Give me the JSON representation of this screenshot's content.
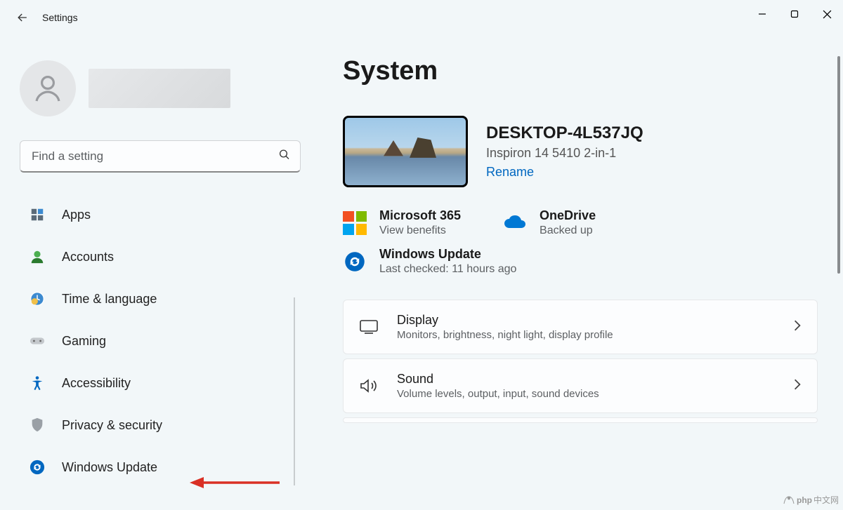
{
  "app_title": "Settings",
  "search": {
    "placeholder": "Find a setting"
  },
  "nav": {
    "apps": "Apps",
    "accounts": "Accounts",
    "time_language": "Time & language",
    "gaming": "Gaming",
    "accessibility": "Accessibility",
    "privacy_security": "Privacy & security",
    "windows_update": "Windows Update"
  },
  "page_title": "System",
  "device": {
    "name": "DESKTOP-4L537JQ",
    "model": "Inspiron 14 5410 2-in-1",
    "rename": "Rename"
  },
  "status": {
    "m365": {
      "title": "Microsoft 365",
      "sub": "View benefits"
    },
    "onedrive": {
      "title": "OneDrive",
      "sub": "Backed up"
    },
    "winupdate": {
      "title": "Windows Update",
      "sub": "Last checked: 11 hours ago"
    }
  },
  "cards": {
    "display": {
      "title": "Display",
      "sub": "Monitors, brightness, night light, display profile"
    },
    "sound": {
      "title": "Sound",
      "sub": "Volume levels, output, input, sound devices"
    }
  },
  "watermark": "中文网"
}
